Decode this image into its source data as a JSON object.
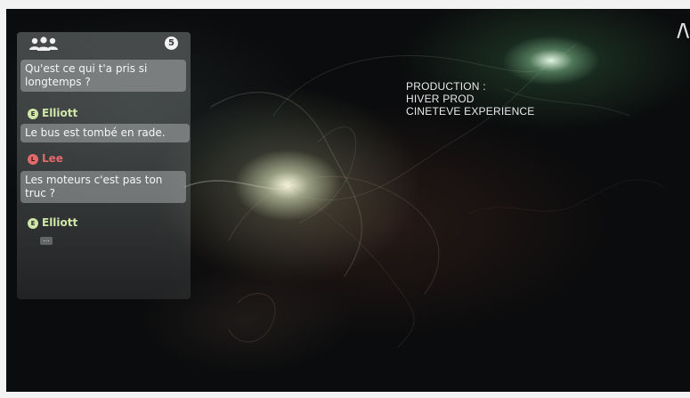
{
  "logo": {
    "text": "/\\"
  },
  "credits": {
    "lines": [
      "PRODUCTION :",
      "HIVER PROD",
      "CINETEVE EXPERIENCE"
    ]
  },
  "chat": {
    "group_icon": "users-icon",
    "participant_count": "5",
    "messages": [
      {
        "type": "bubble",
        "text": "Qu'est ce qui t'a pris si longtemps ?"
      },
      {
        "type": "speaker",
        "initial": "E",
        "name": "Elliott",
        "color": "#cfe8a8"
      },
      {
        "type": "bubble",
        "text": "Le bus est tombé en rade."
      },
      {
        "type": "speaker",
        "initial": "L",
        "name": "Lee",
        "color": "#e36a6a"
      },
      {
        "type": "bubble",
        "text": "Les moteurs c'est pas ton truc ?"
      },
      {
        "type": "speaker",
        "initial": "E",
        "name": "Elliott",
        "color": "#cfe8a8"
      }
    ],
    "typing_indicator": "..."
  }
}
